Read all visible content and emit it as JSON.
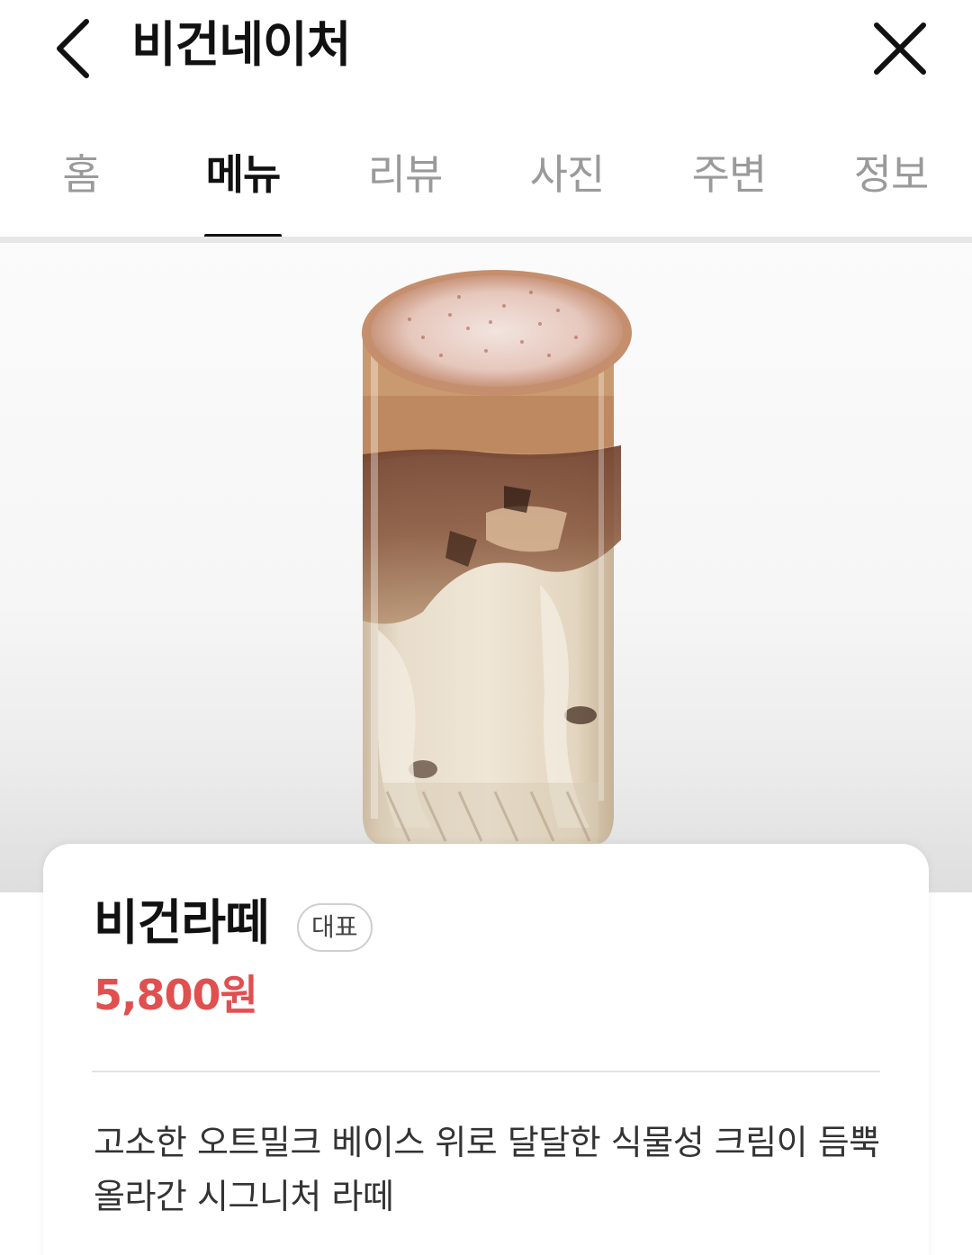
{
  "header": {
    "title": "비건네이처",
    "back_icon": "chevron-left-icon",
    "close_icon": "close-icon"
  },
  "tabs": [
    {
      "label": "홈",
      "active": false
    },
    {
      "label": "메뉴",
      "active": true
    },
    {
      "label": "리뷰",
      "active": false
    },
    {
      "label": "사진",
      "active": false
    },
    {
      "label": "주변",
      "active": false
    },
    {
      "label": "정보",
      "active": false
    }
  ],
  "menu": {
    "name": "비건라떼",
    "badge": "대표",
    "price": "5,800원",
    "description": "고소한 오트밀크 베이스 위로 달달한 식물성 크림이 듬뿍 올라간 시그니처 라떼"
  },
  "colors": {
    "price": "#e0504f",
    "active_tab": "#111111",
    "inactive_tab": "#9a9a9a"
  }
}
